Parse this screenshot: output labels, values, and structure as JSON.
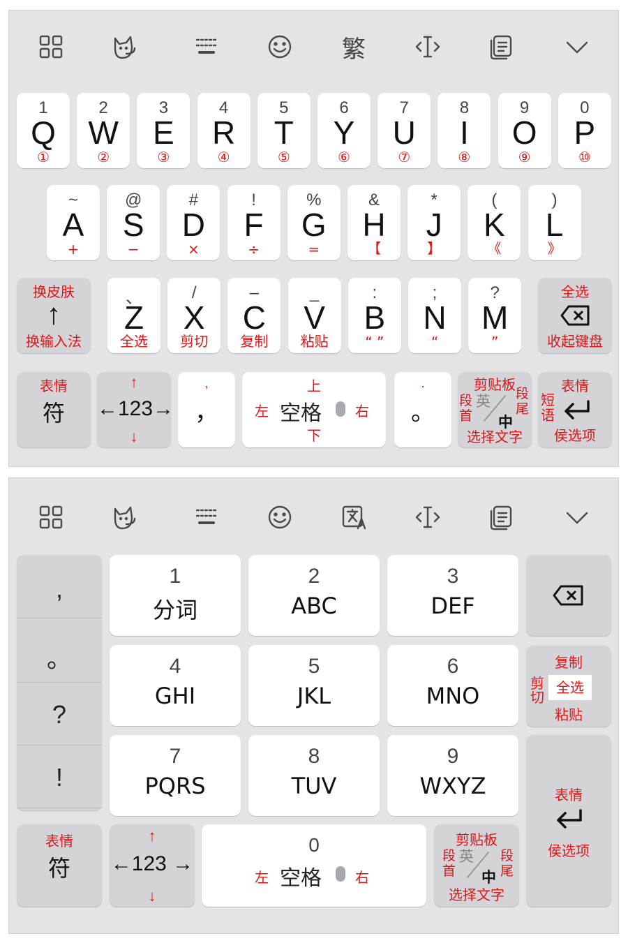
{
  "toolbar_top": {
    "icons": [
      "grid-icon",
      "cat-skin-icon",
      "keyboard-icon",
      "emoji-icon",
      "traditional-chinese-icon",
      "cursor-move-icon",
      "clipboard-icon",
      "collapse-icon"
    ],
    "traditional_label": "繁"
  },
  "qwerty": {
    "row1": [
      {
        "num": "1",
        "letter": "Q",
        "sub": "①"
      },
      {
        "num": "2",
        "letter": "W",
        "sub": "②"
      },
      {
        "num": "3",
        "letter": "E",
        "sub": "③"
      },
      {
        "num": "4",
        "letter": "R",
        "sub": "④"
      },
      {
        "num": "5",
        "letter": "T",
        "sub": "⑤"
      },
      {
        "num": "6",
        "letter": "Y",
        "sub": "⑥"
      },
      {
        "num": "7",
        "letter": "U",
        "sub": "⑦"
      },
      {
        "num": "8",
        "letter": "I",
        "sub": "⑧"
      },
      {
        "num": "9",
        "letter": "O",
        "sub": "⑨"
      },
      {
        "num": "0",
        "letter": "P",
        "sub": "⑩"
      }
    ],
    "row2": [
      {
        "num": "~",
        "letter": "A",
        "sub": "+"
      },
      {
        "num": "@",
        "letter": "S",
        "sub": "−"
      },
      {
        "num": "#",
        "letter": "D",
        "sub": "×"
      },
      {
        "num": "!",
        "letter": "F",
        "sub": "÷"
      },
      {
        "num": "%",
        "letter": "G",
        "sub": "="
      },
      {
        "num": "&",
        "letter": "H",
        "sub": "【"
      },
      {
        "num": "*",
        "letter": "J",
        "sub": "】"
      },
      {
        "num": "(",
        "letter": "K",
        "sub": "《"
      },
      {
        "num": ")",
        "letter": "L",
        "sub": "》"
      }
    ],
    "row3": [
      {
        "num": "、",
        "letter": "Z",
        "sub": "全选"
      },
      {
        "num": "/",
        "letter": "X",
        "sub": "剪切"
      },
      {
        "num": "–",
        "letter": "C",
        "sub": "复制"
      },
      {
        "num": "_",
        "letter": "V",
        "sub": "粘贴"
      },
      {
        "num": ":",
        "letter": "B",
        "sub": "“ ”"
      },
      {
        "num": ";",
        "letter": "N",
        "sub": "“"
      },
      {
        "num": "?",
        "letter": "M",
        "sub": "”"
      }
    ],
    "shift": {
      "top": "换皮肤",
      "arrow": "↑",
      "bottom": "换输入法"
    },
    "backspace": {
      "top": "全选",
      "bottom": "收起键盘"
    },
    "symbol": {
      "top": "表情",
      "main": "符"
    },
    "num123": {
      "main": "←123→",
      "up": "↑",
      "down": "↓"
    },
    "comma": {
      "top": ",",
      "main": "，"
    },
    "space": {
      "up": "上",
      "left": "左",
      "main": "空格",
      "right": "右",
      "down": "下"
    },
    "period": {
      "top": ".",
      "main": "。"
    },
    "lang": {
      "top": "剪贴板",
      "left1": "段",
      "left2": "首",
      "en": "英",
      "zh": "中",
      "right1": "段",
      "right2": "尾",
      "bottom": "选择文字"
    },
    "enter": {
      "top": "表情",
      "side1": "短",
      "side2": "语",
      "bottom": "侯选项"
    }
  },
  "toolbar_bottom": {
    "icons": [
      "grid-icon",
      "cat-skin-icon",
      "keyboard-icon",
      "emoji-icon",
      "translate-icon",
      "cursor-move-icon",
      "clipboard-icon",
      "collapse-icon"
    ]
  },
  "t9": {
    "side": [
      ",",
      "。",
      "?",
      "!"
    ],
    "keys": [
      {
        "num": "1",
        "label": "分词"
      },
      {
        "num": "2",
        "label": "ABC"
      },
      {
        "num": "3",
        "label": "DEF"
      },
      {
        "num": "4",
        "label": "GHI"
      },
      {
        "num": "5",
        "label": "JKL"
      },
      {
        "num": "6",
        "label": "MNO"
      },
      {
        "num": "7",
        "label": "PQRS"
      },
      {
        "num": "8",
        "label": "TUV"
      },
      {
        "num": "9",
        "label": "WXYZ"
      }
    ],
    "edit": {
      "top": "复制",
      "left1": "剪",
      "left2": "切",
      "center": "全选",
      "bottom": "粘贴"
    },
    "enter": {
      "top": "表情",
      "bottom": "侯选项"
    },
    "symbol": {
      "top": "表情",
      "main": "符"
    },
    "num123": {
      "main": "←123 →",
      "up": "↑",
      "down": "↓"
    },
    "space": {
      "num": "0",
      "left": "左",
      "main": "空格",
      "right": "右"
    },
    "lang": {
      "top": "剪贴板",
      "left1": "段",
      "left2": "首",
      "en": "英",
      "zh": "中",
      "right1": "段",
      "right2": "尾",
      "bottom": "选择文字"
    }
  }
}
